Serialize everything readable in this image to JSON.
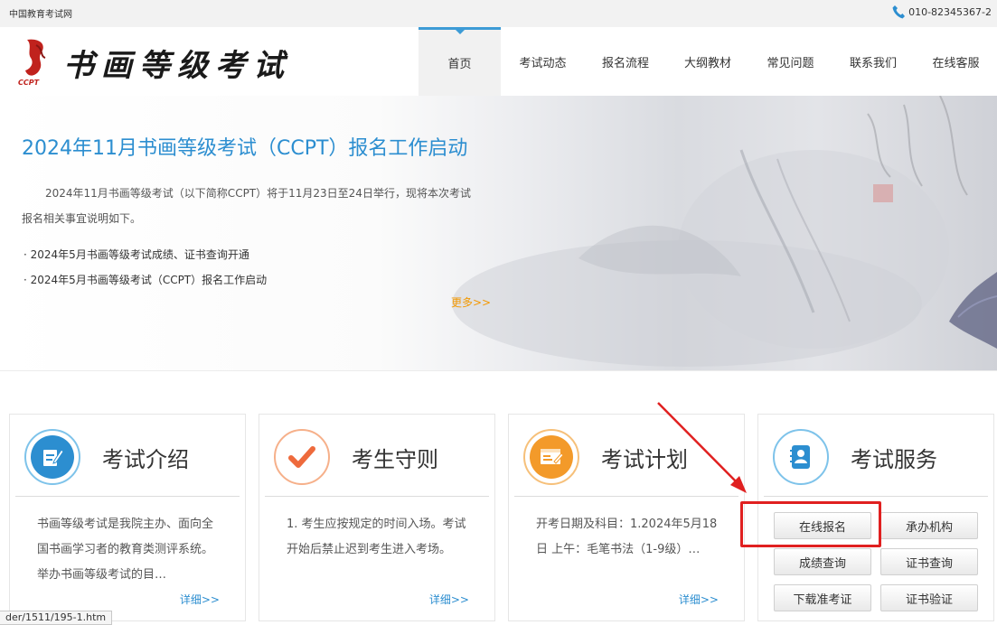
{
  "topbar": {
    "site_name": "中国教育考试网",
    "phone": "010-82345367-2",
    "phone_icon": "phone-icon"
  },
  "header": {
    "logo_text": "书画等级考试",
    "logo_sub": "CCPT",
    "nav": [
      {
        "label": "首页",
        "active": true
      },
      {
        "label": "考试动态"
      },
      {
        "label": "报名流程"
      },
      {
        "label": "大纲教材"
      },
      {
        "label": "常见问题"
      },
      {
        "label": "联系我们"
      },
      {
        "label": "在线客服"
      }
    ]
  },
  "banner": {
    "title": "2024年11月书画等级考试（CCPT）报名工作启动",
    "description": "2024年11月书画等级考试（以下简称CCPT）将于11月23日至24日举行，现将本次考试报名相关事宜说明如下。",
    "items": [
      "2024年5月书画等级考试成绩、证书查询开通",
      "2024年5月书画等级考试（CCPT）报名工作启动"
    ],
    "more": "更多>>"
  },
  "cards": [
    {
      "title": "考试介绍",
      "icon": "document-edit-icon",
      "body": "书画等级考试是我院主办、面向全国书画学习者的教育类测评系统。举办书画等级考试的目…",
      "more": "详细>>"
    },
    {
      "title": "考生守则",
      "icon": "checkmark-icon",
      "body": "1. 考生应按规定的时间入场。考试开始后禁止迟到考生进入考场。",
      "more": "详细>>"
    },
    {
      "title": "考试计划",
      "icon": "calendar-plan-icon",
      "body": "开考日期及科目：1.2024年5月18日 上午：毛笔书法（1-9级）…",
      "more": "详细>>"
    }
  ],
  "services": {
    "title": "考试服务",
    "icon": "address-book-icon",
    "buttons": [
      "在线报名",
      "承办机构",
      "成绩查询",
      "证书查询",
      "下载准考证",
      "证书验证"
    ]
  },
  "status_url": "der/1511/195-1.htm",
  "colors": {
    "accent_blue": "#2c8ed0",
    "more_orange": "#f39800",
    "annotation_red": "#e02020",
    "nav_active_bar": "#3d9bd6"
  }
}
